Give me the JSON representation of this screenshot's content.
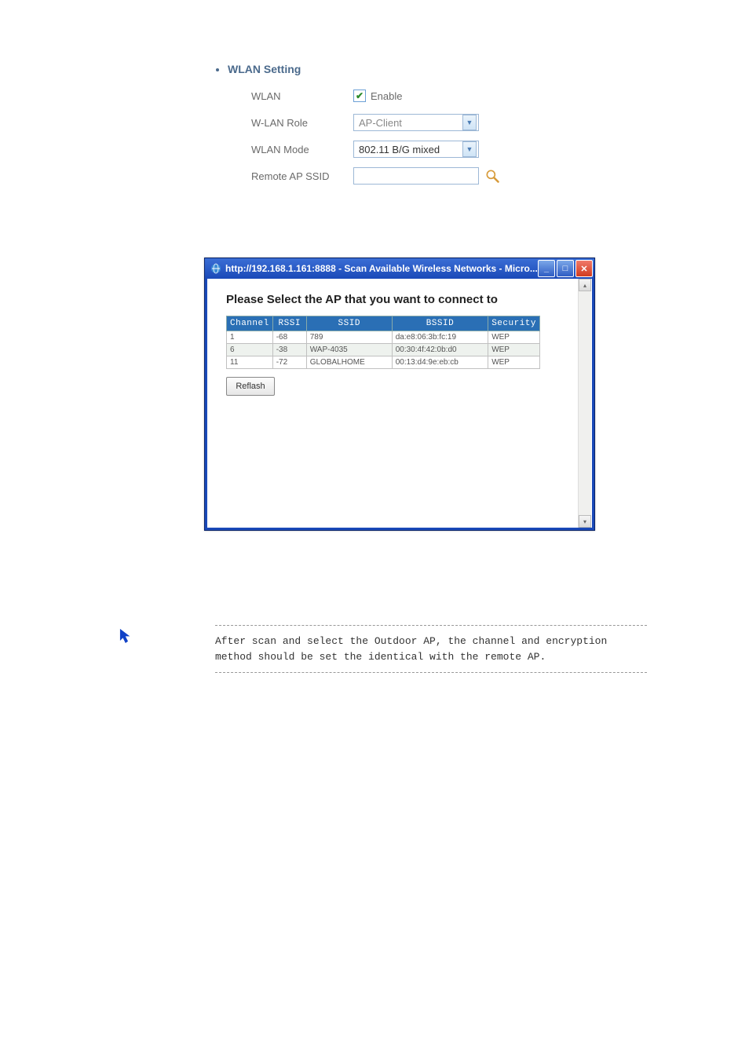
{
  "wlan_section": {
    "title": "WLAN Setting",
    "rows": {
      "wlan_label": "WLAN",
      "wlan_enable_text": "Enable",
      "role_label": "W-LAN Role",
      "role_value": "AP-Client",
      "mode_label": "WLAN Mode",
      "mode_value": "802.11 B/G mixed",
      "remote_label": "Remote AP SSID",
      "remote_value": ""
    }
  },
  "popup": {
    "title": "http://192.168.1.161:8888 - Scan Available Wireless Networks - Micro...",
    "heading": "Please Select the AP that you want to connect to",
    "headers": {
      "channel": "Channel",
      "rssi": "RSSI",
      "ssid": "SSID",
      "bssid": "BSSID",
      "security": "Security"
    },
    "rows": [
      {
        "channel": "1",
        "rssi": "-68",
        "ssid": "789",
        "bssid": "da:e8:06:3b:fc:19",
        "security": "WEP"
      },
      {
        "channel": "6",
        "rssi": "-38",
        "ssid": "WAP-4035",
        "bssid": "00:30:4f:42:0b:d0",
        "security": "WEP"
      },
      {
        "channel": "11",
        "rssi": "-72",
        "ssid": "GLOBALHOME",
        "bssid": "00:13:d4:9e:eb:cb",
        "security": "WEP"
      }
    ],
    "reflash_label": "Reflash"
  },
  "note": {
    "text": "After scan and select the Outdoor AP, the channel and encryption method should be set the identical with the remote AP."
  }
}
